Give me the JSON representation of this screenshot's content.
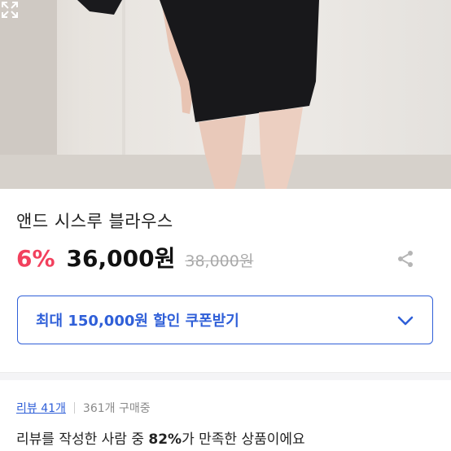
{
  "product": {
    "title": "앤드 시스루 블라우스",
    "discount": "6%",
    "price": "36,000원",
    "original_price": "38,000원"
  },
  "coupon": {
    "label": "최대 150,000원 할인 쿠폰받기"
  },
  "reviews": {
    "link": "리뷰 41개",
    "purchases": "361개 구매중",
    "summary_pre": "리뷰를 작성한 사람 중 ",
    "summary_pct": "82%",
    "summary_post": "가 만족한 상품이에요"
  },
  "colors": {
    "accent": "#2f5fd8",
    "discount": "#f2405d"
  },
  "icons": [
    "expand-icon",
    "share-icon",
    "chevron-down-icon"
  ]
}
